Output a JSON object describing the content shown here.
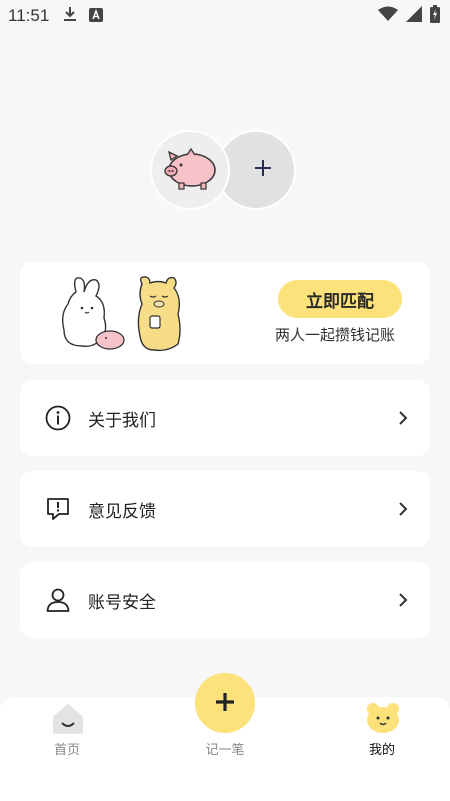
{
  "status_bar": {
    "time": "11:51",
    "left_icons": [
      "download-icon",
      "a-box-icon"
    ],
    "right_icons": [
      "wifi-icon",
      "signal-icon",
      "battery-charging-icon"
    ]
  },
  "couple": {
    "me_avatar": "pig-icon",
    "partner_add": "plus-icon"
  },
  "match_card": {
    "button_label": "立即匹配",
    "description": "两人一起攒钱记账"
  },
  "menu": {
    "items": [
      {
        "label": "关于我们",
        "icon": "info-icon"
      },
      {
        "label": "意见反馈",
        "icon": "feedback-icon"
      },
      {
        "label": "账号安全",
        "icon": "user-icon"
      }
    ]
  },
  "tab_bar": {
    "home_label": "首页",
    "add_label": "记一笔",
    "mine_label": "我的"
  },
  "colors": {
    "accent": "#fde17a",
    "background": "#f7f7f7",
    "card": "#ffffff"
  }
}
